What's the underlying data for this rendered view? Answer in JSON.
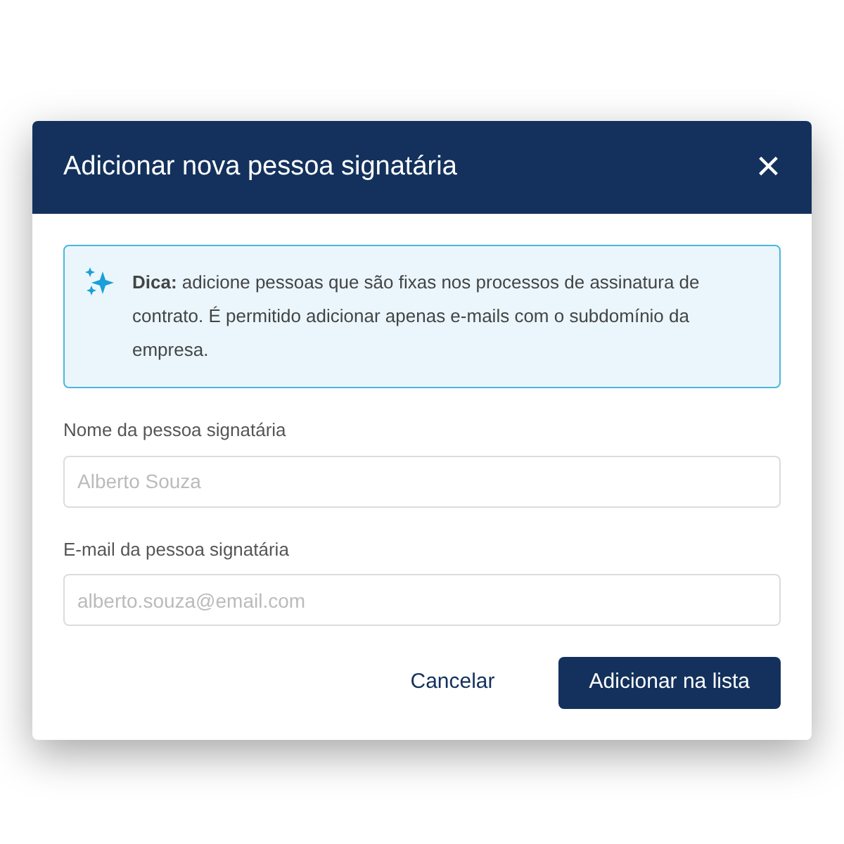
{
  "dialog": {
    "title": "Adicionar nova pessoa signatária",
    "close": "×"
  },
  "tip": {
    "text": "**Dica:** adicione pessoas que são fixas nos processos de assinatura de contrato. É permitido adicionar apenas e-mails com o subdomínio da empresa."
  },
  "fields": [
    {
      "label": "Nome da pessoa signatária",
      "placeholder": "Alberto Souza"
    },
    {
      "label": "E-mail da pessoa signatária",
      "placeholder": "alberto.souza@email.com"
    }
  ],
  "buttons": [
    {
      "label": "Cancelar",
      "kind": "link"
    },
    {
      "label": "Adicionar na lista",
      "kind": "primary"
    }
  ]
}
